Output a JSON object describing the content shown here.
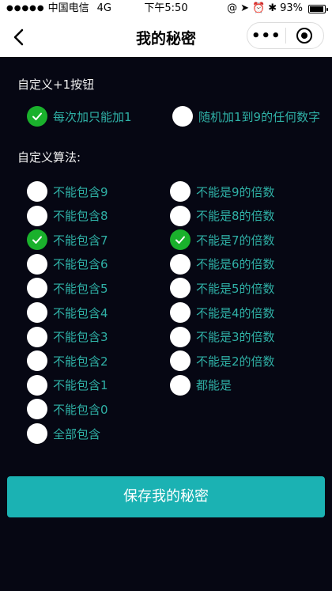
{
  "status_bar": {
    "carrier": "中国电信",
    "network": "4G",
    "time": "下午5:50",
    "battery": "93%"
  },
  "nav": {
    "title": "我的秘密",
    "more_label": "•••"
  },
  "plus_one": {
    "title": "自定义+1按钮",
    "options": [
      {
        "label": "每次加只能加1",
        "selected": true
      },
      {
        "label": "随机加1到9的任何数字",
        "selected": false
      }
    ]
  },
  "algorithm": {
    "title": "自定义算法:",
    "left": [
      {
        "label": "不能包含9",
        "selected": false
      },
      {
        "label": "不能包含8",
        "selected": false
      },
      {
        "label": "不能包含7",
        "selected": true
      },
      {
        "label": "不能包含6",
        "selected": false
      },
      {
        "label": "不能包含5",
        "selected": false
      },
      {
        "label": "不能包含4",
        "selected": false
      },
      {
        "label": "不能包含3",
        "selected": false
      },
      {
        "label": "不能包含2",
        "selected": false
      },
      {
        "label": "不能包含1",
        "selected": false
      },
      {
        "label": "不能包含0",
        "selected": false
      },
      {
        "label": "全部包含",
        "selected": false
      }
    ],
    "right": [
      {
        "label": "不能是9的倍数",
        "selected": false
      },
      {
        "label": "不能是8的倍数",
        "selected": false
      },
      {
        "label": "不能是7的倍数",
        "selected": true
      },
      {
        "label": "不能是6的倍数",
        "selected": false
      },
      {
        "label": "不能是5的倍数",
        "selected": false
      },
      {
        "label": "不能是4的倍数",
        "selected": false
      },
      {
        "label": "不能是3的倍数",
        "selected": false
      },
      {
        "label": "不能是2的倍数",
        "selected": false
      },
      {
        "label": "都能是",
        "selected": false
      }
    ]
  },
  "save_button": {
    "label": "保存我的秘密"
  },
  "colors": {
    "background": "#060713",
    "checked": "#1ab12c",
    "label": "#2fb0a6",
    "button": "#1bb2b3"
  }
}
